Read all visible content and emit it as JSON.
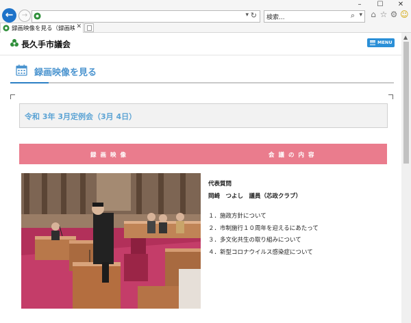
{
  "browser": {
    "window_controls": [
      "–",
      "☐",
      "✕"
    ],
    "search_placeholder": "検索...",
    "tab_title": "録画映像を見る（録画映像...",
    "tab_close": "✕"
  },
  "site": {
    "name": "長久手市議会",
    "menu_label": "MENU"
  },
  "page": {
    "title": "録画映像を見る",
    "session_title": "令和 3年 3月定例会（3月 4日）",
    "band_left": "録画映像",
    "band_right": "会議の内容",
    "question_type": "代表質問",
    "speaker": "岡崎　つよし　議員（芯政クラブ）",
    "topics": [
      "１．施政方針について",
      "２．市制施行１０周年を迎えるにあたって",
      "３．多文化共生の取り組みについて",
      "４．新型コロナウイルス感染症について"
    ]
  },
  "colors": {
    "band": "#ea7c8d",
    "accent_blue": "#2b7fc4",
    "title_blue": "#4b94cf",
    "session_blue": "#5ba3d4",
    "menu_button": "#2a8fd7"
  }
}
